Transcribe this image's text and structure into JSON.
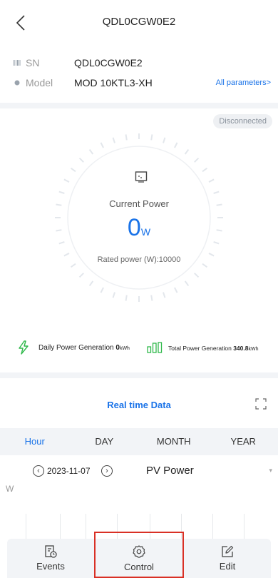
{
  "header": {
    "title": "QDL0CGW0E2",
    "back_icon": "chevron-left-icon"
  },
  "info": {
    "sn": {
      "label": "SN",
      "value": "QDL0CGW0E2",
      "icon": "barcode-icon"
    },
    "model": {
      "label": "Model",
      "value": "MOD 10KTL3-XH",
      "icon": "dot-icon"
    },
    "all_params_link": "All parameters>"
  },
  "status": {
    "badge": "Disconnected"
  },
  "power": {
    "label": "Current Power",
    "value": "0",
    "unit": "W",
    "rated": "Rated power (W):10000"
  },
  "generation": {
    "daily_label": "Daily Power Generation",
    "daily_value": "0",
    "daily_unit": "kWh",
    "total_label": "Total Power Generation",
    "total_value": "340.8",
    "total_unit": "kWh"
  },
  "realtime": {
    "title": "Real time Data",
    "tabs": [
      "Hour",
      "DAY",
      "MONTH",
      "YEAR"
    ],
    "active_tab": "Hour",
    "date": "2023-11-07",
    "metric": "PV Power",
    "y_unit": "W"
  },
  "bottom_nav": [
    {
      "label": "Events",
      "icon": "events-log-icon"
    },
    {
      "label": "Control",
      "icon": "gear-icon"
    },
    {
      "label": "Edit",
      "icon": "edit-icon"
    }
  ],
  "colors": {
    "accent": "#1a73e8",
    "highlight_border": "#d93025",
    "bolt": "#2fb84a"
  }
}
